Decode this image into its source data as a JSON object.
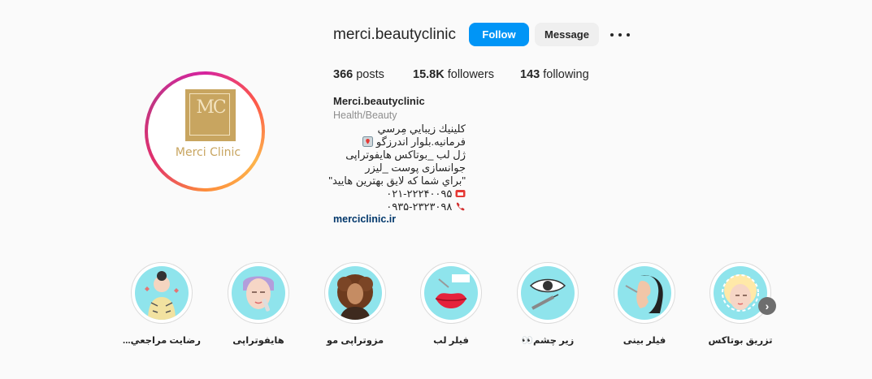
{
  "profile": {
    "username": "merci.beautyclinic",
    "follow_label": "Follow",
    "message_label": "Message",
    "avatar_logo_mark": "MC",
    "avatar_logo_text": "Merci Clinic",
    "stats": {
      "posts_count": "366",
      "posts_label": "posts",
      "followers_count": "15.8K",
      "followers_label": "followers",
      "following_count": "143",
      "following_label": "following"
    },
    "full_name": "Merci.beautyclinic",
    "category": "Health/Beauty",
    "bio": [
      "كلينيك زيبايي مِرسي",
      "فرمانیه.بلوار اندرزگو",
      "ژل لب _بوتاکس هایفوتراپی",
      "جوانسازی پوست _لیزر",
      "\"براي شما كه لايق بهترين هاييد\"",
      "۰۲۱-۲۲۲۴۰۰۹۵",
      "۰۹۳۵-۲۳۲۳۰۹۸"
    ],
    "link": "merciclinic.ir"
  },
  "highlights": [
    {
      "label": "رضايت مراجعي...",
      "icon": "patient-illustration"
    },
    {
      "label": "هايفوتراپی",
      "icon": "face-treatment-illustration"
    },
    {
      "label": "مزوتراپی مو",
      "icon": "hair-woman-illustration"
    },
    {
      "label": "فیلر لب",
      "icon": "lips-illustration"
    },
    {
      "label": "زیر چشم👀",
      "icon": "eye-syringe-illustration"
    },
    {
      "label": "فیلر بینی",
      "icon": "nose-profile-illustration"
    },
    {
      "label": "تزریق بوتاکس",
      "icon": "botox-face-illustration"
    }
  ],
  "highlight_next": "›",
  "colors": {
    "follow": "#0095f6",
    "link": "#00376b",
    "highlight_bg": "#8fe4ec"
  }
}
